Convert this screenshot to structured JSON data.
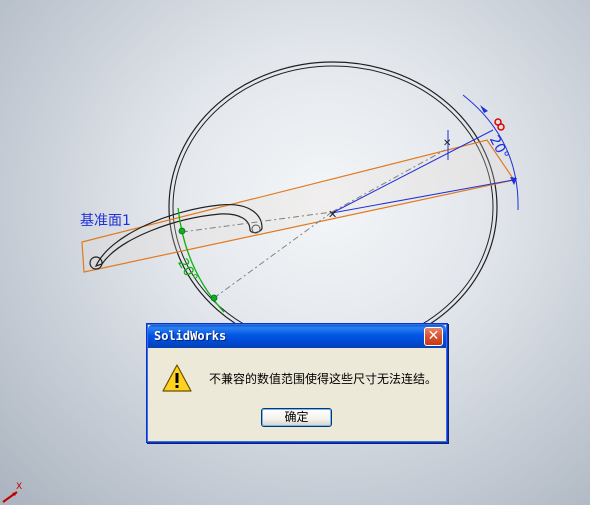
{
  "viewport": {
    "plane_label": "基准面1",
    "dimension_green": "20°",
    "dimension_blue": "20°",
    "triad_axis": "X"
  },
  "dialog": {
    "title": "SolidWorks",
    "message": "不兼容的数值范围使得这些尺寸无法连结。",
    "ok_label": "确定",
    "close_glyph": "✕",
    "icon": "warning-icon"
  },
  "colors": {
    "sketch_blue": "#2030d8",
    "plane_orange": "#e07a20",
    "dim_green": "#10b010",
    "titlebar_blue": "#0055e5",
    "dialog_face": "#ece9d8"
  }
}
